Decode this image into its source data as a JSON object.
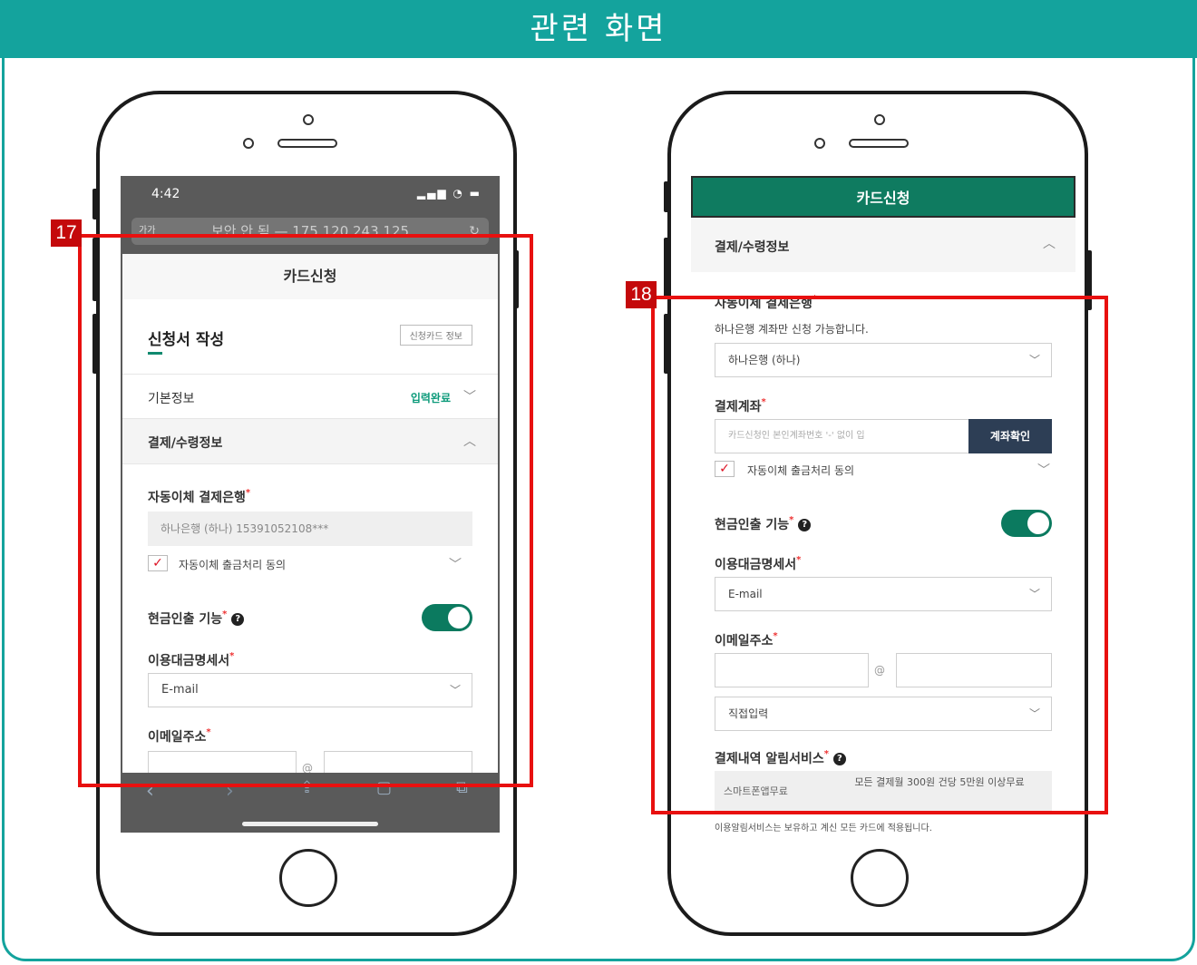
{
  "header": {
    "title": "관련 화면"
  },
  "annotations": {
    "left_tag": "17",
    "right_tag": "18"
  },
  "left": {
    "status_time": "4:42",
    "status_icons": "▂▄▆ ◔ ▬",
    "url_aa": "가가",
    "url_text": "보안 안 됨 — 175.120.243.125",
    "app_title": "카드신청",
    "section_title": "신청서 작성",
    "card_info_button": "신청카드 정보",
    "basic_info": "기본정보",
    "basic_info_status": "입력완료",
    "payment_section": "결제/수령정보",
    "auto_bank_label": "자동이체 결제은행",
    "auto_bank_value": "하나은행 (하나) 15391052108***",
    "auto_agree": "자동이체 출금처리 동의",
    "cash_label": "현금인출 기능",
    "statement_label": "이용대금명세서",
    "statement_value": "E-mail",
    "email_label": "이메일주소",
    "at_sign": "@"
  },
  "right": {
    "app_title": "카드신청",
    "payment_section": "결제/수령정보",
    "auto_bank_label": "자동이체 결제은행",
    "bank_note": "하나은행 계좌만 신청 가능합니다.",
    "bank_value": "하나은행 (하나)",
    "account_label": "결제계좌",
    "account_placeholder": "카드신청인 본인계좌번호 '-' 없이 입",
    "account_confirm": "계좌확인",
    "auto_agree": "자동이체 출금처리 동의",
    "cash_label": "현금인출 기능",
    "statement_label": "이용대금명세서",
    "statement_value": "E-mail",
    "email_label": "이메일주소",
    "at_sign": "@",
    "email_domain_select": "직접입력",
    "alert_label": "결제내역 알림서비스",
    "alert_option1": "스마트폰앱무료",
    "alert_option2": "모든 결제월 300원 건당 5만원 이상무료",
    "alert_note": "이용알림서비스는 보유하고 계신 모든 카드에 적용됩니다."
  }
}
